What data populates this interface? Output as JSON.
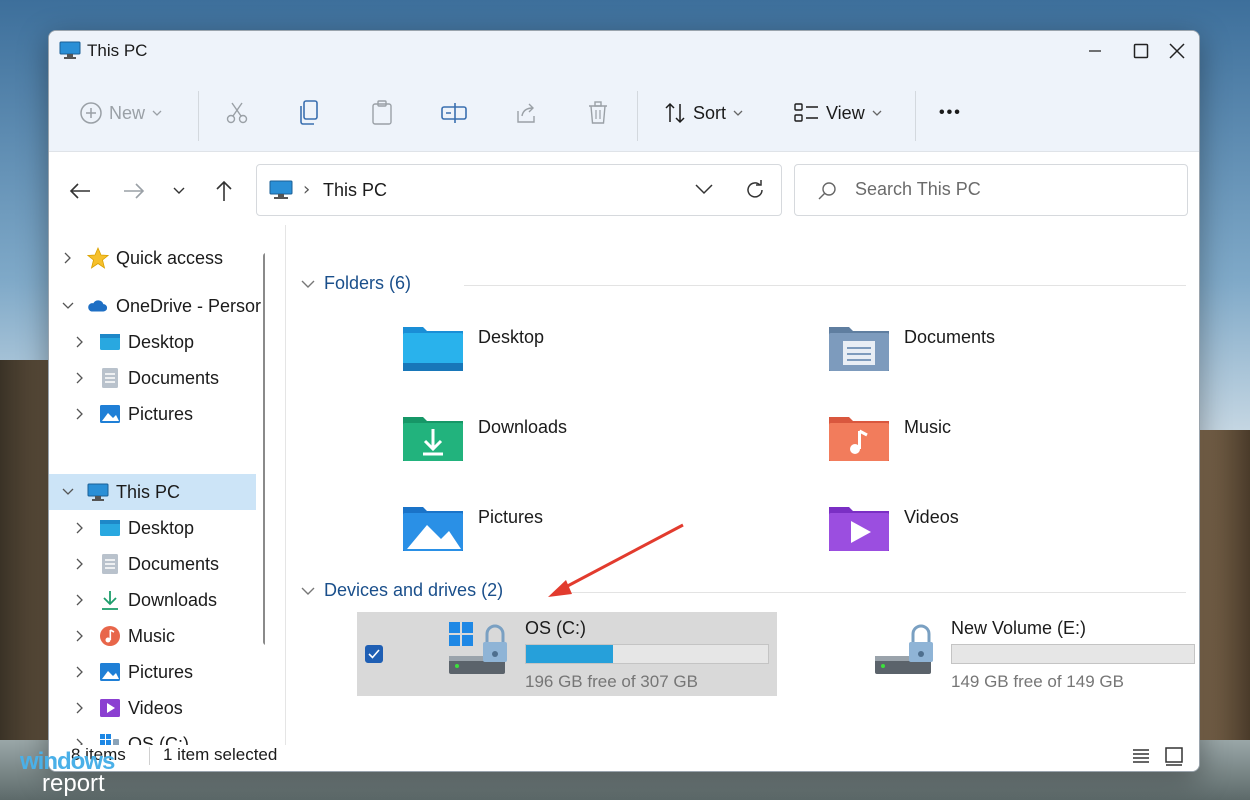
{
  "window": {
    "title": "This PC"
  },
  "toolbar": {
    "new_label": "New",
    "sort_label": "Sort",
    "view_label": "View",
    "more_label": "•••"
  },
  "address": {
    "location": "This PC",
    "separator": "›"
  },
  "search": {
    "placeholder": "Search This PC"
  },
  "sidebar": {
    "items": [
      {
        "label": "Quick access"
      },
      {
        "label": "OneDrive - Persor"
      },
      {
        "label": "Desktop"
      },
      {
        "label": "Documents"
      },
      {
        "label": "Pictures"
      },
      {
        "label": "This PC"
      },
      {
        "label": "Desktop"
      },
      {
        "label": "Documents"
      },
      {
        "label": "Downloads"
      },
      {
        "label": "Music"
      },
      {
        "label": "Pictures"
      },
      {
        "label": "Videos"
      },
      {
        "label": "OS (C:)"
      }
    ]
  },
  "folders": {
    "header": "Folders (6)",
    "items": [
      {
        "label": "Desktop"
      },
      {
        "label": "Documents"
      },
      {
        "label": "Downloads"
      },
      {
        "label": "Music"
      },
      {
        "label": "Pictures"
      },
      {
        "label": "Videos"
      }
    ]
  },
  "drives": {
    "header": "Devices and drives (2)",
    "items": [
      {
        "label": "OS (C:)",
        "free_text": "196 GB free of 307 GB",
        "used_fraction": 0.36,
        "selected": true
      },
      {
        "label": "New Volume (E:)",
        "free_text": "149 GB free of 149 GB",
        "used_fraction": 0.0,
        "selected": false
      }
    ]
  },
  "status": {
    "count": "8 items",
    "selection": "1 item selected"
  },
  "watermark": {
    "line1": "windows",
    "line2": "report"
  },
  "colors": {
    "accent": "#26a0da",
    "selection": "#cce4f7",
    "header_blue": "#1a4f8b"
  }
}
